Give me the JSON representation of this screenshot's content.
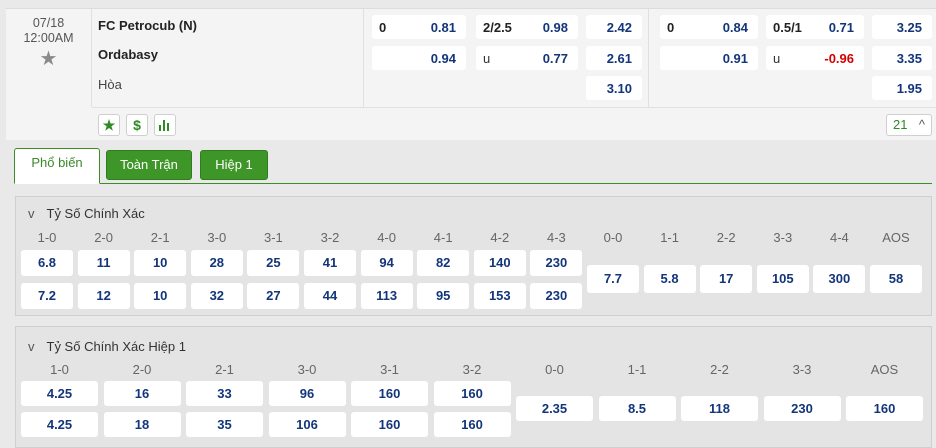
{
  "match": {
    "date": "07/18",
    "time": "12:00AM",
    "home": "FC Petrocub (N)",
    "away": "Ordabasy",
    "draw_label": "Hòa",
    "ft_hdp": {
      "line": "0",
      "home": "0.81",
      "away": "0.94"
    },
    "ft_ou": {
      "line": "2/2.5",
      "over": "0.98",
      "under_label": "u",
      "under": "0.77"
    },
    "ft_1x2": {
      "home": "2.42",
      "away": "2.61",
      "draw": "3.10"
    },
    "h1_hdp": {
      "line": "0",
      "home": "0.84",
      "away": "0.91"
    },
    "h1_ou": {
      "line": "0.5/1",
      "over": "0.71",
      "under_label": "u",
      "under": "-0.96"
    },
    "h1_1x2": {
      "home": "3.25",
      "away": "3.35",
      "draw": "1.95"
    },
    "more_count": "21"
  },
  "tabs": [
    "Phổ biến",
    "Toàn Trận",
    "Hiệp 1"
  ],
  "panel1": {
    "title": "Tỷ Số Chính Xác",
    "headers": [
      "1-0",
      "2-0",
      "2-1",
      "3-0",
      "3-1",
      "3-2",
      "4-0",
      "4-1",
      "4-2",
      "4-3",
      "0-0",
      "1-1",
      "2-2",
      "3-3",
      "4-4",
      "AOS"
    ],
    "home": [
      "6.8",
      "11",
      "10",
      "28",
      "25",
      "41",
      "94",
      "82",
      "140",
      "230"
    ],
    "away": [
      "7.2",
      "12",
      "10",
      "32",
      "27",
      "44",
      "113",
      "95",
      "153",
      "230"
    ],
    "draws": [
      "7.7",
      "5.8",
      "17",
      "105",
      "300",
      "58"
    ]
  },
  "panel2": {
    "title": "Tỷ Số Chính Xác Hiệp 1",
    "headers": [
      "1-0",
      "2-0",
      "2-1",
      "3-0",
      "3-1",
      "3-2",
      "0-0",
      "1-1",
      "2-2",
      "3-3",
      "AOS"
    ],
    "home": [
      "4.25",
      "16",
      "33",
      "96",
      "160",
      "160"
    ],
    "away": [
      "4.25",
      "18",
      "35",
      "106",
      "160",
      "160"
    ],
    "draws": [
      "2.35",
      "8.5",
      "118",
      "230",
      "160"
    ]
  }
}
